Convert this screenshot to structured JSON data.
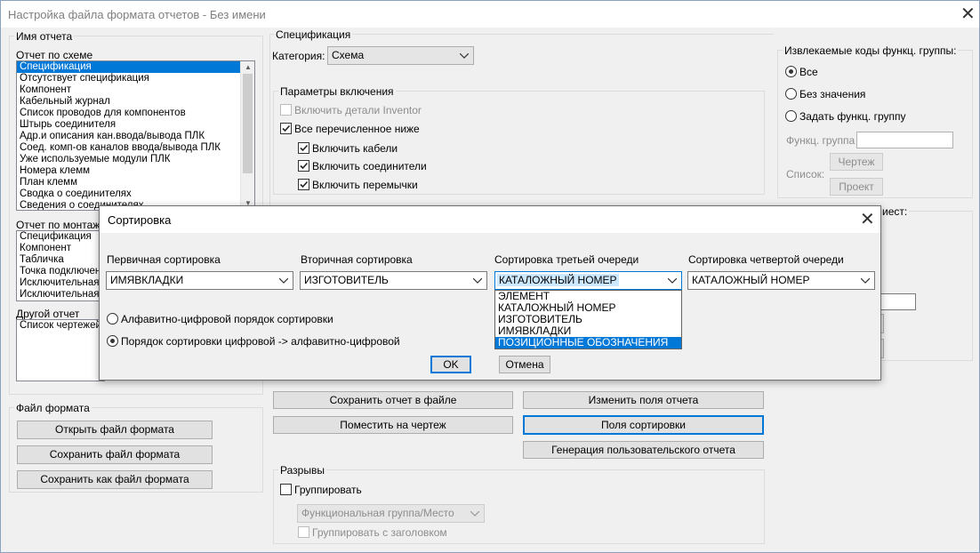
{
  "window": {
    "title": "Настройка файла формата отчетов - Без имени"
  },
  "report_name": {
    "group_label": "Имя отчета",
    "schematic_label": "Отчет по схеме",
    "schematic_items": [
      "Спецификация",
      "Отсутствует спецификация",
      "Компонент",
      "Кабельный журнал",
      "Список проводов для компонентов",
      "Штырь соединителя",
      "Адр.и описания кан.ввода/вывода ПЛК",
      "Соед. комп-ов каналов ввода/вывода ПЛК",
      "Уже используемые модули ПЛК",
      "Номера клемм",
      "План клемм",
      "Сводка о соединителях",
      "Сведения о соединителях"
    ],
    "panel_label": "Отчет по монтажной",
    "panel_items": [
      "Спецификация",
      "Компонент",
      "Табличка",
      "Точка подключения",
      "Исключительная с",
      "Исключительная с"
    ],
    "other_label": "Другой отчет",
    "other_items": [
      "Список чертежей"
    ]
  },
  "format_file": {
    "group_label": "Файл формата",
    "open_btn": "Открыть файл формата",
    "save_btn": "Сохранить файл формата",
    "save_as_btn": "Сохранить как файл формата"
  },
  "spec": {
    "group_label": "Спецификация",
    "category_label": "Категория:",
    "category_value": "Схема"
  },
  "inclusion": {
    "group_label": "Параметры включения",
    "inventor_details": "Включить детали Inventor",
    "all_listed": "Все перечисленное ниже",
    "cables": "Включить кабели",
    "connectors": "Включить соединители",
    "jumpers": "Включить перемычки"
  },
  "extracted_codes": {
    "group_label": "Извлекаемые коды функц. группы:",
    "all": "Все",
    "no_value": "Без значения",
    "set_group": "Задать функц. группу",
    "group_label_field": "Функц. группа",
    "list_label": "Список:",
    "drawing_btn": "Чертеж",
    "project_btn": "Проект"
  },
  "right_group2_label_fragment": "иест:",
  "actions": {
    "save_to_file": "Сохранить отчет в файле",
    "change_fields": "Изменить поля отчета",
    "put_on_drawing": "Поместить на чертеж",
    "sort_fields": "Поля сортировки",
    "custom_report": "Генерация пользовательского отчета"
  },
  "breaks": {
    "group_label": "Разрывы",
    "group_checkbox": "Группировать",
    "combo_value": "Функциональная группа/Место",
    "with_header": "Группировать с заголовком"
  },
  "sort_dialog": {
    "title": "Сортировка",
    "primary_label": "Первичная сортировка",
    "primary_value": "ИМЯВКЛАДКИ",
    "secondary_label": "Вторичная сортировка",
    "secondary_value": "ИЗГОТОВИТЕЛЬ",
    "third_label": "Сортировка третьей очереди",
    "third_value": "КАТАЛОЖНЫЙ НОМЕР",
    "fourth_label": "Сортировка четвертой очереди",
    "fourth_value": "КАТАЛОЖНЫЙ НОМЕР",
    "radio_alpha": "Алфавитно-цифровой порядок сортировки",
    "radio_numeric": "Порядок сортировки цифровой -> алфавитно-цифровой",
    "ok": "OK",
    "cancel": "Отмена",
    "third_dropdown_items": [
      "ЭЛЕМЕНТ",
      "КАТАЛОЖНЫЙ НОМЕР",
      "ИЗГОТОВИТЕЛЬ",
      "ИМЯВКЛАДКИ",
      "ПОЗИЦИОННЫЕ ОБОЗНАЧЕНИЯ"
    ]
  }
}
